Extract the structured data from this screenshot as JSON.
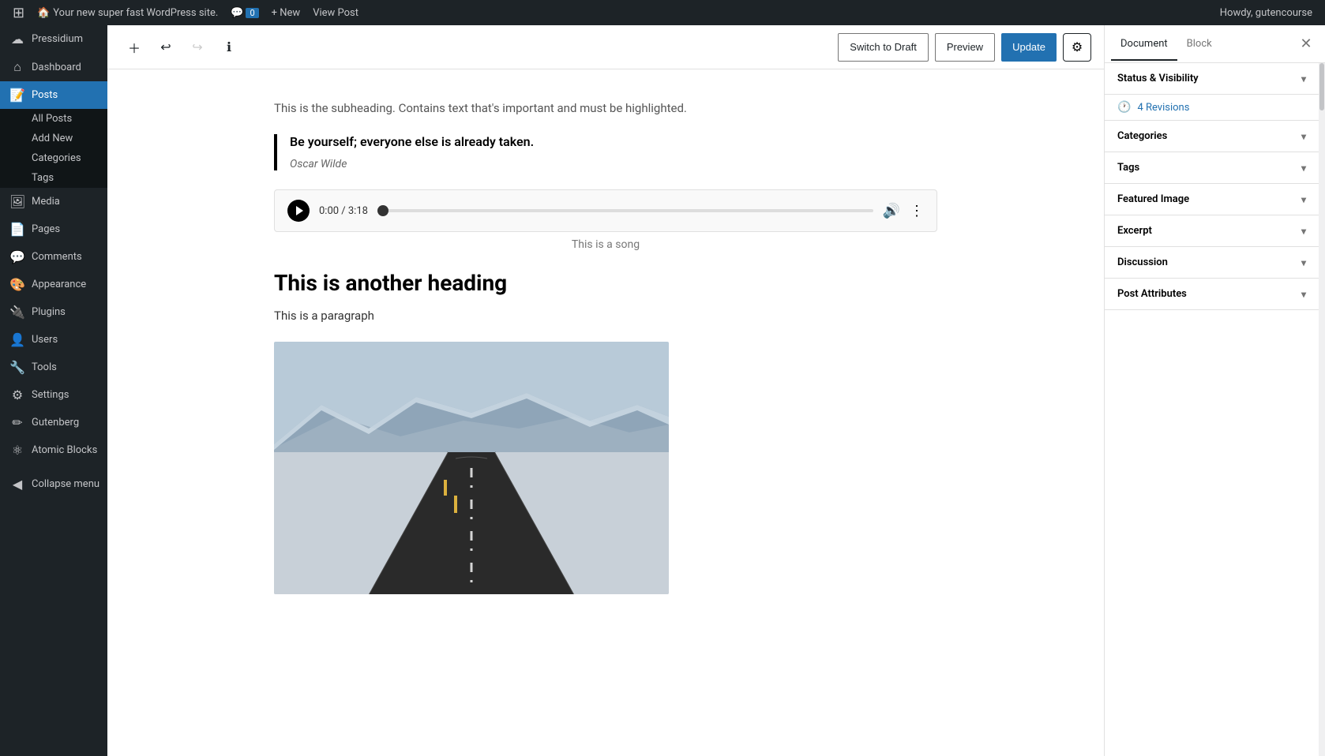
{
  "adminBar": {
    "wpIcon": "⊞",
    "site": {
      "icon": "🏠",
      "name": "Your new super fast WordPress site."
    },
    "comments": {
      "icon": "💬",
      "count": "0"
    },
    "newLabel": "+ New",
    "viewPost": "View Post",
    "howdy": "Howdy, gutencourse"
  },
  "sidebar": {
    "logo": "⊞",
    "items": [
      {
        "id": "pressidium",
        "icon": "☁",
        "label": "Pressidium",
        "active": false
      },
      {
        "id": "dashboard",
        "icon": "⌂",
        "label": "Dashboard",
        "active": false
      },
      {
        "id": "posts",
        "icon": "📝",
        "label": "Posts",
        "active": true
      },
      {
        "id": "all-posts",
        "icon": "",
        "label": "All Posts",
        "sub": true
      },
      {
        "id": "add-new",
        "icon": "",
        "label": "Add New",
        "sub": true
      },
      {
        "id": "categories",
        "icon": "",
        "label": "Categories",
        "sub": true
      },
      {
        "id": "tags",
        "icon": "",
        "label": "Tags",
        "sub": true
      },
      {
        "id": "media",
        "icon": "🖼",
        "label": "Media",
        "active": false
      },
      {
        "id": "pages",
        "icon": "📄",
        "label": "Pages",
        "active": false
      },
      {
        "id": "comments",
        "icon": "💬",
        "label": "Comments",
        "active": false
      },
      {
        "id": "appearance",
        "icon": "🎨",
        "label": "Appearance",
        "active": false
      },
      {
        "id": "plugins",
        "icon": "🔌",
        "label": "Plugins",
        "active": false
      },
      {
        "id": "users",
        "icon": "👤",
        "label": "Users",
        "active": false
      },
      {
        "id": "tools",
        "icon": "🔧",
        "label": "Tools",
        "active": false
      },
      {
        "id": "settings",
        "icon": "⚙",
        "label": "Settings",
        "active": false
      },
      {
        "id": "gutenberg",
        "icon": "✏",
        "label": "Gutenberg",
        "active": false
      },
      {
        "id": "atomic-blocks",
        "icon": "⚛",
        "label": "Atomic Blocks",
        "active": false
      },
      {
        "id": "collapse-menu",
        "icon": "◀",
        "label": "Collapse menu",
        "active": false
      }
    ]
  },
  "toolbar": {
    "addBlock": "＋",
    "undo": "↩",
    "redo": "↪",
    "info": "ℹ",
    "switchToDraft": "Switch to Draft",
    "preview": "Preview",
    "update": "Update",
    "settingsGear": "⚙"
  },
  "editor": {
    "subheading": "This is the subheading. Contains text that's important and must be highlighted.",
    "blockquote": {
      "text": "Be yourself; everyone else is already taken.",
      "cite": "Oscar Wilde"
    },
    "audio": {
      "time": "0:00 / 3:18",
      "caption": "This is a song"
    },
    "heading2": "This is another heading",
    "paragraph": "This is a paragraph"
  },
  "rightPanel": {
    "documentTab": "Document",
    "blockTab": "Block",
    "sections": [
      {
        "id": "status-visibility",
        "label": "Status & Visibility",
        "open": true
      },
      {
        "id": "revisions",
        "label": "4 Revisions",
        "icon": "🕐",
        "type": "revisions"
      },
      {
        "id": "categories",
        "label": "Categories",
        "open": false
      },
      {
        "id": "tags",
        "label": "Tags",
        "open": false
      },
      {
        "id": "featured-image",
        "label": "Featured Image",
        "open": false
      },
      {
        "id": "excerpt",
        "label": "Excerpt",
        "open": false
      },
      {
        "id": "discussion",
        "label": "Discussion",
        "open": false
      },
      {
        "id": "post-attributes",
        "label": "Post Attributes",
        "open": false
      }
    ]
  }
}
